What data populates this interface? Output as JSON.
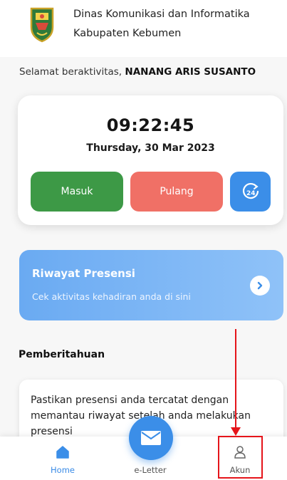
{
  "header": {
    "org_line1": "Dinas Komunikasi dan Informatika",
    "org_line2": "Kabupaten Kebumen",
    "logo_icon": "kebumen-regency-emblem"
  },
  "greeting": {
    "prefix": "Selamat beraktivitas,",
    "name": "NANANG ARIS SUSANTO"
  },
  "clock": {
    "time": "09:22:45",
    "date": "Thursday, 30 Mar 2023",
    "buttons": {
      "masuk": "Masuk",
      "pulang": "Pulang",
      "history24_icon": "clock-24-icon"
    }
  },
  "riwayat": {
    "title": "Riwayat Presensi",
    "subtitle": "Cek aktivitas kehadiran anda di sini"
  },
  "notifications": {
    "title": "Pemberitahuan",
    "message": "Pastikan presensi anda tercatat dengan memantau riwayat setelah anda melakukan presensi"
  },
  "bottom_nav": {
    "items": [
      {
        "label": "Home",
        "icon": "home-icon",
        "active": true
      },
      {
        "label": "e-Letter",
        "icon": "envelope-icon",
        "active": false
      },
      {
        "label": "Akun",
        "icon": "user-icon",
        "active": false
      }
    ]
  },
  "colors": {
    "masuk": "#3d9946",
    "pulang": "#f07066",
    "primary": "#3b8ee8",
    "annotation": "#e5141a"
  }
}
